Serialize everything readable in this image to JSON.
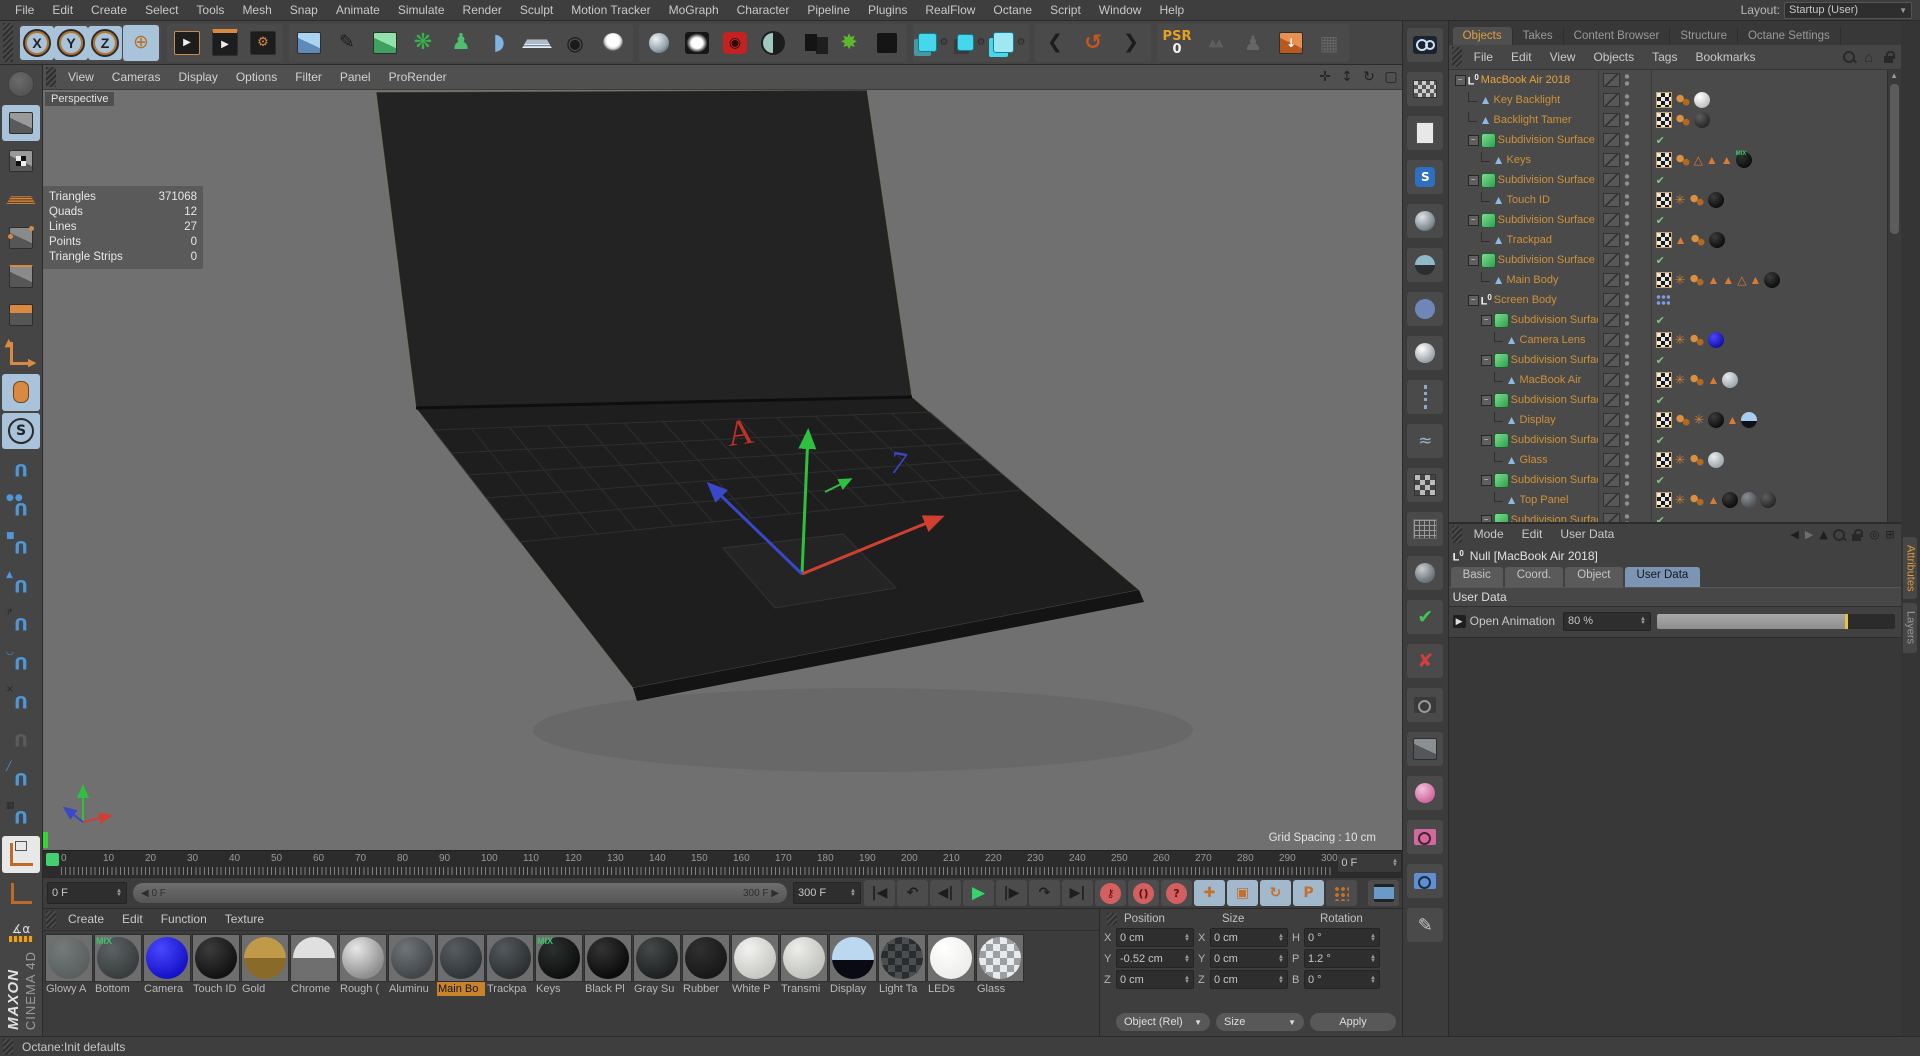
{
  "menubar": {
    "items": [
      "File",
      "Edit",
      "Create",
      "Select",
      "Tools",
      "Mesh",
      "Snap",
      "Animate",
      "Simulate",
      "Render",
      "Sculpt",
      "Motion Tracker",
      "MoGraph",
      "Character",
      "Pipeline",
      "Plugins",
      "RealFlow",
      "Octane",
      "Script",
      "Window",
      "Help"
    ],
    "layout_label": "Layout:",
    "layout_value": "Startup (User)"
  },
  "toolbar": {
    "psr_label": "PSR",
    "psr_value": "0",
    "axis_locks": [
      "X",
      "Y",
      "Z"
    ],
    "groups": [
      {
        "name": "axis-lock-group",
        "kind": "xyz"
      },
      {
        "name": "render-group",
        "icons": [
          "render-view-icon",
          "render-picture-viewer-icon",
          "render-settings-icon"
        ]
      },
      {
        "name": "create-group",
        "icons": [
          "primitive-cube-icon",
          "spline-pen-icon",
          "generator-cube-icon",
          "mograph-icon",
          "character-icon",
          "deformer-icon",
          "floor-icon",
          "camera-icon",
          "light-icon"
        ]
      },
      {
        "name": "octane-group",
        "icons": [
          "octane-sphere-icon",
          "octane-softbox-icon",
          "octane-camera-icon",
          "octane-halfdisc-icon",
          "octane-boxes-icon",
          "octane-fan-icon",
          "octane-square-icon"
        ]
      },
      {
        "name": "scene-group",
        "icons": [
          "scene-folder-icon",
          "scene-folder2-icon",
          "scene-folder3-icon"
        ]
      },
      {
        "name": "nav-group",
        "icons": [
          "history-back-icon",
          "undo-icon",
          "history-forward-icon"
        ]
      },
      {
        "name": "psr-group",
        "icons": [
          "psr-badge",
          "align-triangles-icon",
          "walk-figure-icon",
          "drop-to-floor-icon",
          "toolbox-icon"
        ]
      }
    ]
  },
  "left_toolbar": {
    "items": [
      {
        "name": "convert-tool-button",
        "icon": "globe",
        "dim": true
      },
      {
        "name": "model-mode-button",
        "icon": "cube-model",
        "active": true
      },
      {
        "name": "texture-mode-button",
        "icon": "cube-texture"
      },
      {
        "name": "workplane-mode-button",
        "icon": "workplane"
      },
      {
        "name": "points-mode-button",
        "icon": "cube-points"
      },
      {
        "name": "edges-mode-button",
        "icon": "cube-edges"
      },
      {
        "name": "polygons-mode-button",
        "icon": "cube-polys"
      },
      {
        "name": "enable-axis-button",
        "icon": "axis"
      },
      {
        "name": "tweak-mode-button",
        "icon": "mouse",
        "active": true
      },
      {
        "name": "snap-toggle-button",
        "icon": "snap-s",
        "active": true
      },
      {
        "name": "snap-settings-button",
        "icon": "magnet"
      },
      {
        "name": "vertex-snap-button",
        "icon": "magnet-dots"
      },
      {
        "name": "edge-snap-button",
        "icon": "magnet-square"
      },
      {
        "name": "polygon-snap-button",
        "icon": "magnet-tri"
      },
      {
        "name": "axis-snap-button",
        "icon": "magnet-axis"
      },
      {
        "name": "spline-snap-button",
        "icon": "magnet-spline"
      },
      {
        "name": "intersection-snap-button",
        "icon": "magnet-x"
      },
      {
        "name": "midpoint-snap-button",
        "icon": "magnet-dim",
        "dim": true
      },
      {
        "name": "perpendicular-snap-button",
        "icon": "magnet-line"
      },
      {
        "name": "grid-point-snap-button",
        "icon": "magnet-grid"
      },
      {
        "name": "workplane-lock-button",
        "icon": "wp-lock",
        "hl": true
      },
      {
        "name": "planar-workplane-button",
        "icon": "wp-corner"
      },
      {
        "name": "quantize-button",
        "icon": "angle-ruler"
      }
    ],
    "logo_maxon": "MAXON",
    "logo_c4d": "CINEMA 4D"
  },
  "viewport": {
    "menu_items": [
      "View",
      "Cameras",
      "Display",
      "Options",
      "Filter",
      "Panel",
      "ProRender"
    ],
    "nav_icons": [
      {
        "name": "pan-view-icon",
        "glyph": "✛"
      },
      {
        "name": "zoom-view-icon",
        "glyph": "↕"
      },
      {
        "name": "rotate-view-icon",
        "glyph": "↻"
      },
      {
        "name": "toggle-panel-icon",
        "glyph": "▢"
      }
    ],
    "view_label": "Perspective",
    "stats": [
      {
        "label": "Triangles",
        "value": "371068"
      },
      {
        "label": "Quads",
        "value": "12"
      },
      {
        "label": "Lines",
        "value": "27"
      },
      {
        "label": "Points",
        "value": "0"
      },
      {
        "label": "Triangle Strips",
        "value": "0"
      }
    ],
    "grid_spacing": "Grid Spacing : 10 cm",
    "axis_letter_red": "A",
    "axis_letter_blue": "7"
  },
  "timeline": {
    "labels": [
      "0",
      "10",
      "20",
      "30",
      "40",
      "50",
      "60",
      "70",
      "80",
      "90",
      "100",
      "110",
      "120",
      "130",
      "140",
      "150",
      "160",
      "170",
      "180",
      "190",
      "200",
      "210",
      "220",
      "230",
      "240",
      "250",
      "260",
      "270",
      "280",
      "290",
      "300"
    ],
    "ruler_frame_field": "0 F"
  },
  "transport": {
    "frame_field": "0 F",
    "range_start": "0 F",
    "range_end": "300 F",
    "end_field": "300 F",
    "buttons": [
      {
        "name": "goto-start-button",
        "glyph": "|◀"
      },
      {
        "name": "prev-key-button",
        "glyph": "↶"
      },
      {
        "name": "prev-frame-button",
        "glyph": "◀|"
      },
      {
        "name": "play-button",
        "glyph": "▶",
        "kind": "play"
      },
      {
        "name": "next-frame-button",
        "glyph": "|▶"
      },
      {
        "name": "next-key-button",
        "glyph": "↷"
      },
      {
        "name": "goto-end-button",
        "glyph": "▶|"
      },
      {
        "name": "record-keyframe-button",
        "glyph": "⚿",
        "kind": "rec"
      },
      {
        "name": "autokey-button",
        "glyph": "()",
        "kind": "rec"
      },
      {
        "name": "record-options-button",
        "glyph": "?",
        "kind": "rec"
      },
      {
        "name": "key-position-toggle",
        "glyph": "✚",
        "kind": "orange"
      },
      {
        "name": "key-scale-toggle",
        "glyph": "▣",
        "kind": "orange"
      },
      {
        "name": "key-rotation-toggle",
        "glyph": "↻",
        "kind": "orange"
      },
      {
        "name": "key-parameter-toggle",
        "glyph": "P",
        "kind": "orange"
      },
      {
        "name": "key-pla-toggle",
        "glyph": "",
        "kind": "dots"
      },
      {
        "name": "motion-system-button",
        "glyph": "",
        "kind": "film"
      }
    ]
  },
  "materials": {
    "menu": [
      "Create",
      "Edit",
      "Function",
      "Texture"
    ],
    "items": [
      {
        "label": "Glowy A",
        "base": "#5a5f5f",
        "hi": "#747a7a",
        "kind": "flat"
      },
      {
        "label": "Bottom",
        "base": "#393d3e",
        "hi": "#5c6264",
        "badge": "MIX"
      },
      {
        "label": "Camera",
        "base": "#1512c8",
        "hi": "#4a48ff"
      },
      {
        "label": "Touch ID",
        "base": "#121212",
        "hi": "#3c3c3c"
      },
      {
        "label": "Gold",
        "base": "#8a6a28",
        "hi": "#c09a48",
        "kind": "half"
      },
      {
        "label": "Chrome",
        "base": "#6f6f6f",
        "hi": "#e0e0e0",
        "kind": "half"
      },
      {
        "label": "Rough (",
        "base": "#8f8f8f",
        "hi": "#e8e8e8"
      },
      {
        "label": "Aluminu",
        "base": "#42464a",
        "hi": "#6e7478"
      },
      {
        "label": "Main Bo",
        "base": "#31363a",
        "hi": "#565c60",
        "selected": true
      },
      {
        "label": "Trackpa",
        "base": "#2c3032",
        "hi": "#53595c"
      },
      {
        "label": "Keys",
        "base": "#0d100e",
        "hi": "#2c302e",
        "badge": "MIX"
      },
      {
        "label": "Black Pl",
        "base": "#0b0b0b",
        "hi": "#343434"
      },
      {
        "label": "Gray Su",
        "base": "#1e2122",
        "hi": "#45494a"
      },
      {
        "label": "Rubber",
        "base": "#181818",
        "hi": "#303030"
      },
      {
        "label": "White P",
        "base": "#c8c8c5",
        "hi": "#f2f2f0"
      },
      {
        "label": "Transmi",
        "base": "#c2c4bf",
        "hi": "#ededea"
      },
      {
        "label": "Display",
        "base": "#0a0a14",
        "hi": "#a8cdf0",
        "kind": "display"
      },
      {
        "label": "Light Ta",
        "base": "#2a2d2e",
        "hi": "#4a4e50",
        "kind": "checker"
      },
      {
        "label": "LEDs",
        "base": "#eeeeec",
        "hi": "#ffffff"
      },
      {
        "label": "Glass",
        "base": "#cfd2d4",
        "hi": "#f2f4f6",
        "kind": "glass"
      }
    ]
  },
  "coords": {
    "columns": [
      {
        "header": "Position",
        "rows": [
          {
            "axis": "X",
            "value": "0 cm"
          },
          {
            "axis": "Y",
            "value": "-0.52 cm"
          },
          {
            "axis": "Z",
            "value": "0 cm"
          }
        ]
      },
      {
        "header": "Size",
        "rows": [
          {
            "axis": "X",
            "value": "0 cm"
          },
          {
            "axis": "Y",
            "value": "0 cm"
          },
          {
            "axis": "Z",
            "value": "0 cm"
          }
        ]
      },
      {
        "header": "Rotation",
        "rows": [
          {
            "axis": "H",
            "value": "0 °"
          },
          {
            "axis": "P",
            "value": "1.2 °"
          },
          {
            "axis": "B",
            "value": "0 °"
          }
        ]
      }
    ],
    "dropdown1": "Object (Rel)",
    "dropdown2": "Size",
    "apply": "Apply"
  },
  "right_strip": {
    "items": [
      {
        "name": "live-viewer-camera-icon",
        "icon": "r-cam"
      },
      {
        "name": "render-region-icon",
        "icon": "r-gridcam"
      },
      {
        "name": "clipboard-icon",
        "icon": "r-doc"
      },
      {
        "name": "substance-icon",
        "icon": "r-s"
      },
      {
        "name": "material-sphere-icon",
        "icon": "r-sph1"
      },
      {
        "name": "hemisphere-icon",
        "icon": "r-hemi"
      },
      {
        "name": "disc-icon",
        "icon": "r-disc"
      },
      {
        "name": "specular-sphere-icon",
        "icon": "r-sph2"
      },
      {
        "name": "dotted-line-icon",
        "icon": "r-dotline"
      },
      {
        "name": "wave-icon",
        "icon": "r-wave"
      },
      {
        "name": "checkerboard-icon",
        "icon": "r-checker"
      },
      {
        "name": "grid-icon",
        "icon": "r-grid"
      },
      {
        "name": "gray-sphere-icon",
        "icon": "r-sph3"
      },
      {
        "name": "check-icon",
        "icon": "r-check"
      },
      {
        "name": "cross-icon",
        "icon": "r-x"
      },
      {
        "name": "camera2-icon",
        "icon": "r-cam2"
      },
      {
        "name": "cube-icon",
        "icon": "r-cube"
      },
      {
        "name": "pink-sphere-icon",
        "icon": "r-pink"
      },
      {
        "name": "pink-camera-icon",
        "icon": "r-pinkcam"
      },
      {
        "name": "blue-camera-icon",
        "icon": "r-bluecam"
      },
      {
        "name": "pen-icon",
        "icon": "r-pen"
      }
    ]
  },
  "right_panel": {
    "tabs": [
      {
        "label": "Objects",
        "active": true
      },
      {
        "label": "Takes",
        "active": false
      },
      {
        "label": "Content Browser",
        "active": false
      },
      {
        "label": "Structure",
        "active": false
      },
      {
        "label": "Octane Settings",
        "active": false
      }
    ],
    "menu": [
      "File",
      "Edit",
      "View",
      "Objects",
      "Tags",
      "Bookmarks"
    ],
    "tree": [
      {
        "name": "MacBook Air 2018",
        "depth": 0,
        "type": "null",
        "exp": true,
        "bright": true,
        "tags": []
      },
      {
        "name": "Key Backlight",
        "depth": 1,
        "type": "poly",
        "tags": [
          "checker",
          "phong",
          "tex-white"
        ]
      },
      {
        "name": "Backlight Tamer",
        "depth": 1,
        "type": "poly",
        "tags": [
          "checker",
          "phong",
          "tex-dark"
        ]
      },
      {
        "name": "Subdivision Surface",
        "depth": 1,
        "type": "sds",
        "exp": true,
        "check": true,
        "tags": []
      },
      {
        "name": "Keys",
        "depth": 2,
        "type": "poly",
        "tags": [
          "checker",
          "phong",
          "tri-o",
          "tri",
          "tri",
          "tex-mix"
        ]
      },
      {
        "name": "Subdivision Surface",
        "depth": 1,
        "type": "sds",
        "exp": true,
        "check": true,
        "tags": []
      },
      {
        "name": "Touch ID",
        "depth": 2,
        "type": "poly",
        "tags": [
          "checker",
          "burst",
          "phong",
          "tex-black"
        ]
      },
      {
        "name": "Subdivision Surface",
        "depth": 1,
        "type": "sds",
        "exp": true,
        "check": true,
        "tags": []
      },
      {
        "name": "Trackpad",
        "depth": 2,
        "type": "poly",
        "tags": [
          "checker",
          "tri",
          "phong",
          "tex-black"
        ]
      },
      {
        "name": "Subdivision Surface",
        "depth": 1,
        "type": "sds",
        "exp": true,
        "check": true,
        "tags": []
      },
      {
        "name": "Main Body",
        "depth": 2,
        "type": "poly",
        "tags": [
          "checker",
          "burst",
          "phong",
          "tri",
          "tri",
          "tri-o",
          "tri",
          "tex-black"
        ]
      },
      {
        "name": "Screen Body",
        "depth": 1,
        "type": "null",
        "exp": true,
        "tags": [
          "ik"
        ]
      },
      {
        "name": "Subdivision Surface",
        "depth": 2,
        "type": "sds",
        "exp": true,
        "check": true,
        "tags": []
      },
      {
        "name": "Camera Lens",
        "depth": 3,
        "type": "poly",
        "tags": [
          "checker",
          "burst",
          "phong",
          "tex-blue"
        ]
      },
      {
        "name": "Subdivision Surface",
        "depth": 2,
        "type": "sds",
        "exp": true,
        "check": true,
        "tags": []
      },
      {
        "name": "MacBook Air",
        "depth": 3,
        "type": "poly",
        "tags": [
          "checker",
          "burst",
          "phong",
          "tri",
          "tex-glass"
        ]
      },
      {
        "name": "Subdivision Surface",
        "depth": 2,
        "type": "sds",
        "exp": true,
        "check": true,
        "tags": []
      },
      {
        "name": "Display",
        "depth": 3,
        "type": "poly",
        "tags": [
          "checker",
          "phong",
          "burst",
          "tex-black",
          "tri",
          "tex-image"
        ]
      },
      {
        "name": "Subdivision Surface",
        "depth": 2,
        "type": "sds",
        "exp": true,
        "check": true,
        "tags": []
      },
      {
        "name": "Glass",
        "depth": 3,
        "type": "poly",
        "tags": [
          "checker",
          "burst",
          "phong",
          "tex-glass"
        ]
      },
      {
        "name": "Subdivision Surface",
        "depth": 2,
        "type": "sds",
        "exp": true,
        "check": true,
        "tags": []
      },
      {
        "name": "Top Panel",
        "depth": 3,
        "type": "poly",
        "tags": [
          "checker",
          "burst",
          "phong",
          "tri",
          "tex-black",
          "tex-gray",
          "tex-dark"
        ]
      },
      {
        "name": "Subdivision Surface",
        "depth": 2,
        "type": "sds",
        "exp": true,
        "check": true,
        "tags": []
      }
    ]
  },
  "attributes": {
    "menu": [
      "Mode",
      "Edit",
      "User Data"
    ],
    "object_label": "Null [MacBook Air 2018]",
    "tabs": [
      "Basic",
      "Coord.",
      "Object",
      "User Data"
    ],
    "active_tab": "User Data",
    "section": "User Data",
    "param_label": "Open Animation",
    "param_value": "80 %",
    "slider_percent": 79
  },
  "edge_tabs": [
    "Attributes",
    "Layers"
  ],
  "statusbar": {
    "text": "Octane:Init defaults"
  },
  "colors": {
    "object_text": "#cf9136",
    "selected_material": "#c8832c",
    "active_tab_blue": "#7d95b5",
    "play_green": "#35d46e",
    "playhead_green": "#46cf6e"
  }
}
